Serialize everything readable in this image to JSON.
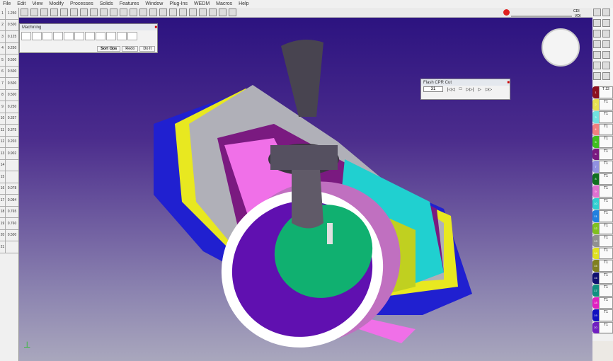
{
  "menu": [
    "File",
    "Edit",
    "View",
    "Modify",
    "Processes",
    "Solids",
    "Features",
    "Window",
    "Plug-Ins",
    "WEDM",
    "Macros",
    "Help"
  ],
  "machining_panel": {
    "title": "Machining",
    "sort_ops": "Sort Ops",
    "redo": "Redo",
    "do_it": "Do It"
  },
  "flash_panel": {
    "title": "Flash CPR Cut",
    "speed_value": "31"
  },
  "status": {
    "cpr": "CDI",
    "vdi": "VDI"
  },
  "left_tools": [
    {
      "n": "1",
      "v": "1.250"
    },
    {
      "n": "2",
      "v": "0.500"
    },
    {
      "n": "3",
      "v": "0.125"
    },
    {
      "n": "4",
      "v": "0.250"
    },
    {
      "n": "5",
      "v": "0.500"
    },
    {
      "n": "6",
      "v": "0.500"
    },
    {
      "n": "7",
      "v": "0.500"
    },
    {
      "n": "8",
      "v": "0.500"
    },
    {
      "n": "9",
      "v": "0.250"
    },
    {
      "n": "10",
      "v": "0.337"
    },
    {
      "n": "11",
      "v": "0.375"
    },
    {
      "n": "12",
      "v": "0.203"
    },
    {
      "n": "13",
      "v": "0.902"
    },
    {
      "n": "14",
      "v": ""
    },
    {
      "n": "15",
      "v": ""
    },
    {
      "n": "16",
      "v": "0.078"
    },
    {
      "n": "17",
      "v": "0.094"
    },
    {
      "n": "18",
      "v": "0.765"
    },
    {
      "n": "19",
      "v": "0.760"
    },
    {
      "n": "20",
      "v": "0.500"
    },
    {
      "n": "21",
      "v": ""
    }
  ],
  "operations": [
    {
      "n": "1",
      "t": "T 22",
      "color": "#8b1020"
    },
    {
      "n": "2",
      "t": "T1",
      "color": "#e8e050"
    },
    {
      "n": "3",
      "t": "T1",
      "color": "#70e0e0"
    },
    {
      "n": "4",
      "t": "T1",
      "color": "#f08080"
    },
    {
      "n": "5",
      "t": "T1",
      "color": "#40c020"
    },
    {
      "n": "6",
      "t": "T1",
      "color": "#7a1a80"
    },
    {
      "n": "7",
      "t": "T1",
      "color": "#9090e0"
    },
    {
      "n": "8",
      "t": "T1",
      "color": "#107020"
    },
    {
      "n": "9",
      "t": "T1",
      "color": "#e070d0"
    },
    {
      "n": "10",
      "t": "T1",
      "color": "#30d0d0"
    },
    {
      "n": "11",
      "t": "T1",
      "color": "#2080e0"
    },
    {
      "n": "12",
      "t": "T1",
      "color": "#80c020"
    },
    {
      "n": "13",
      "t": "T1",
      "color": "#909090"
    },
    {
      "n": "14",
      "t": "T1",
      "color": "#e0e020"
    },
    {
      "n": "15",
      "t": "T1",
      "color": "#808020"
    },
    {
      "n": "16",
      "t": "T1",
      "color": "#101070"
    },
    {
      "n": "17",
      "t": "T1",
      "color": "#109080"
    },
    {
      "n": "18",
      "t": "T1",
      "color": "#e020c0"
    },
    {
      "n": "19",
      "t": "T1",
      "color": "#1010c0"
    },
    {
      "n": "20",
      "t": "T1",
      "color": "#7020c0"
    }
  ]
}
